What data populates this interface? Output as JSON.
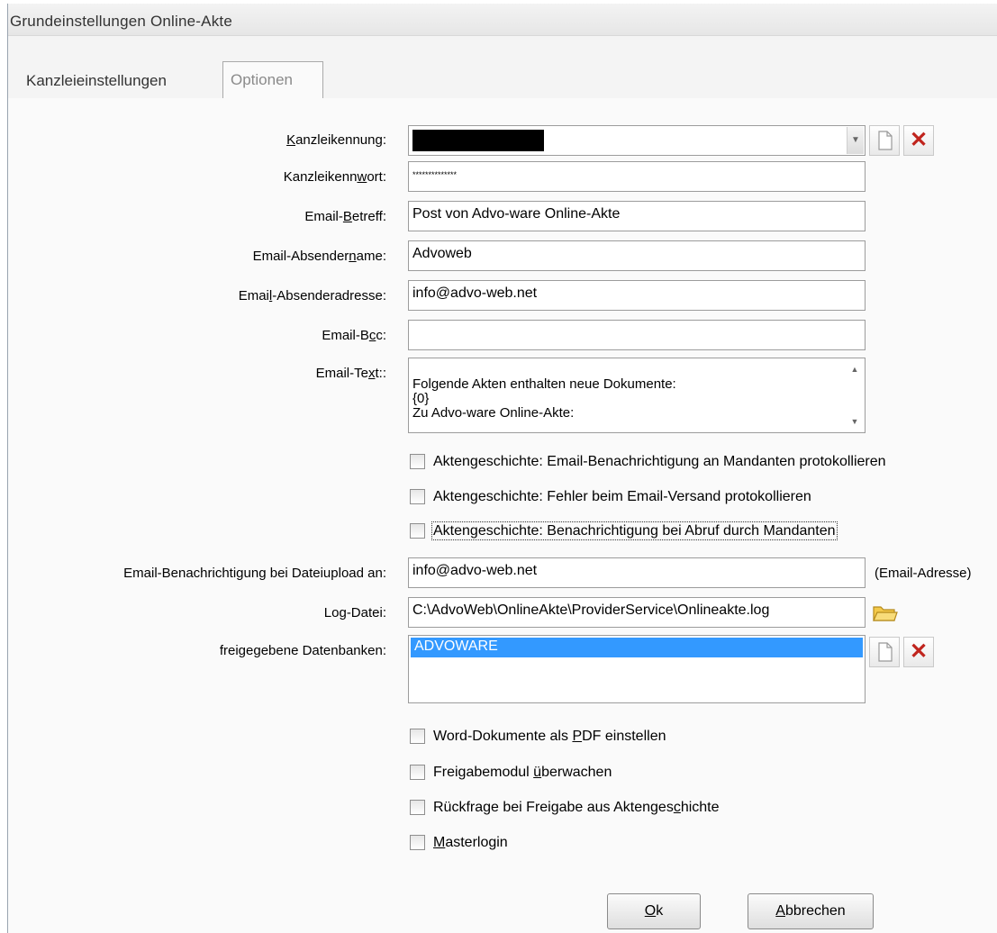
{
  "window": {
    "title": "Grundeinstellungen Online-Akte"
  },
  "tabs": [
    {
      "label": "Kanzleieinstellungen",
      "active": false
    },
    {
      "label": "Optionen",
      "active": true
    }
  ],
  "fields": {
    "kanzleikennung": {
      "label_pre": "",
      "label_u": "K",
      "label_post": "anzleikennung:",
      "value": ""
    },
    "kanzleikennwort": {
      "label_pre": "Kanzleikenn",
      "label_u": "w",
      "label_post": "ort:",
      "value": "**************"
    },
    "betreff": {
      "label_pre": "Email-",
      "label_u": "B",
      "label_post": "etreff:",
      "value": "Post von Advo-ware Online-Akte"
    },
    "absendername": {
      "label_pre": "Email-Absender",
      "label_u": "n",
      "label_post": "ame:",
      "value": "Advoweb"
    },
    "absenderadresse": {
      "label_pre": "Emai",
      "label_u": "l",
      "label_post": "-Absenderadresse:",
      "value": "info@advo-web.net"
    },
    "bcc": {
      "label_pre": "Email-B",
      "label_u": "c",
      "label_post": "c:",
      "value": ""
    },
    "text": {
      "label_pre": "Email-Te",
      "label_u": "x",
      "label_post": "t::",
      "value": "Folgende Akten enthalten neue Dokumente:\n{0}\nZu Advo-ware Online-Akte:"
    }
  },
  "checks_top": [
    {
      "label": "Aktengeschichte: Email-Benachrichtigung an Mandanten protokollieren",
      "checked": false
    },
    {
      "label": "Aktengeschichte: Fehler beim Email-Versand protokollieren",
      "checked": false
    },
    {
      "label": "Aktengeschichte: Benachrichtigung bei Abruf durch Mandanten",
      "checked": false
    }
  ],
  "upload": {
    "label": "Email-Benachrichtigung bei Dateiupload an:",
    "value": "info@advo-web.net",
    "hint": "(Email-Adresse)"
  },
  "logfile": {
    "label_pre": "Lo",
    "label_u": "g",
    "label_post": "-Datei:",
    "value": "C:\\AdvoWeb\\OnlineAkte\\ProviderService\\Onlineakte.log"
  },
  "databases": {
    "label": "freigegebene Datenbanken:",
    "items": [
      "ADVOWARE"
    ]
  },
  "checks_bottom": [
    {
      "label_pre": "Word-Dokumente als ",
      "label_u": "P",
      "label_post": "DF einstellen",
      "checked": false
    },
    {
      "label_pre": "Freigabemodul ",
      "label_u": "ü",
      "label_post": "berwachen",
      "checked": false
    },
    {
      "label_pre": "Rückfrage bei Freigabe aus Aktenges",
      "label_u": "c",
      "label_post": "hichte",
      "checked": false
    },
    {
      "label_pre": "",
      "label_u": "M",
      "label_post": "asterlogin",
      "checked": false
    }
  ],
  "buttons": {
    "ok": {
      "u": "O",
      "rest": "k"
    },
    "cancel": {
      "u": "A",
      "rest": "bbrechen"
    }
  },
  "icons": {
    "new": "new-document-icon",
    "delete": "delete-x-icon",
    "folder": "open-folder-icon"
  },
  "colors": {
    "selection": "#3399ff",
    "delete": "#c0241d"
  }
}
